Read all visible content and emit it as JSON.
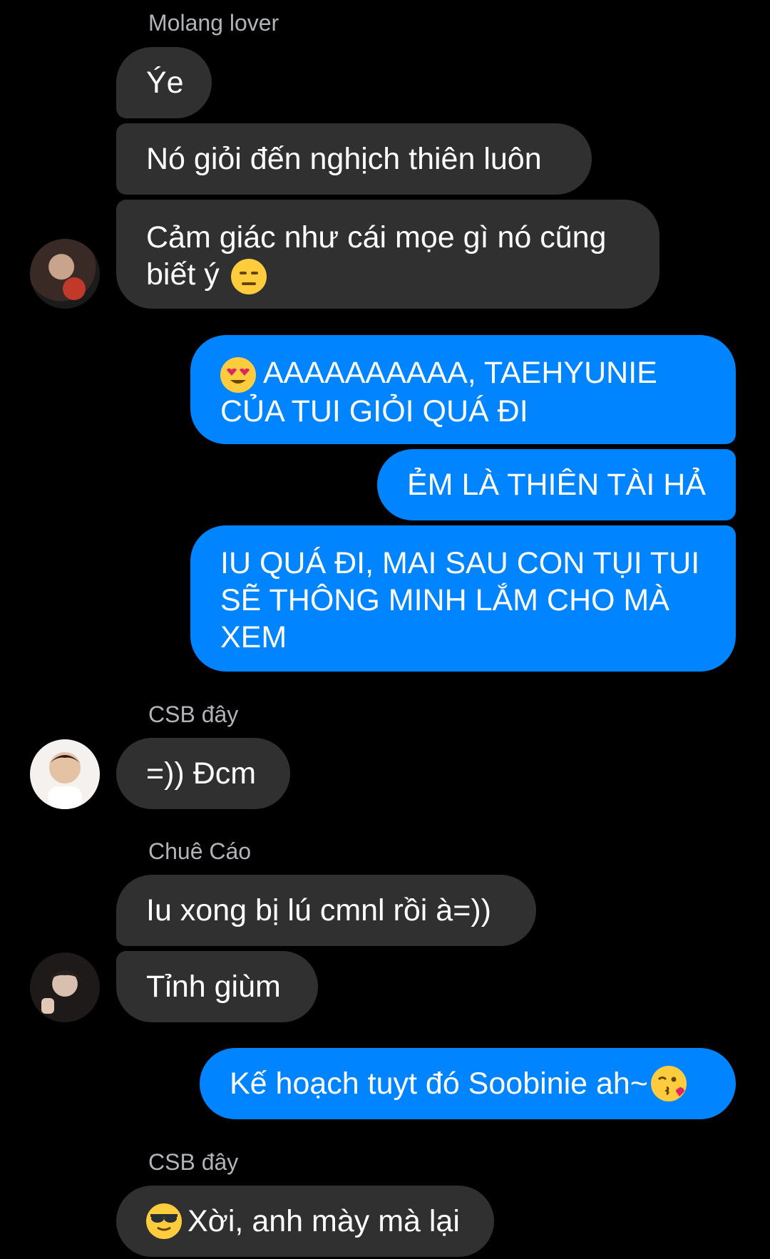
{
  "thread": [
    {
      "sender": "Molang lover"
    },
    {
      "text": "Ýe"
    },
    {
      "text": "Nó giỏi đến nghịch thiên luôn"
    },
    {
      "text": "Cảm giác như cái mọe gì nó cũng biết ý"
    },
    {
      "text": "AAAAAAAAAA, TAEHYUNIE CỦA TUI GIỎI QUÁ ĐI"
    },
    {
      "text": "ẺM LÀ THIÊN TÀI HẢ"
    },
    {
      "text": "IU QUÁ ĐI, MAI SAU CON TỤI TUI SẼ THÔNG MINH LẮM CHO MÀ XEM"
    },
    {
      "sender": "CSB đây"
    },
    {
      "text": "=)) Đcm"
    },
    {
      "sender": "Chuê Cáo"
    },
    {
      "text": "Iu xong bị lú cmnl rồi à=))"
    },
    {
      "text": "Tỉnh giùm"
    },
    {
      "text": "Kế hoạch tuyt đó Soobinie ah~"
    },
    {
      "sender": "CSB đây"
    },
    {
      "text": "Xời, anh mày mà lại"
    }
  ],
  "emojis": {
    "expressionless": "expressionless-face-emoji",
    "heart_eyes": "heart-eyes-emoji",
    "kiss_wink": "face-blowing-kiss-emoji",
    "sunglasses": "sunglasses-face-emoji"
  },
  "colors": {
    "background": "#000000",
    "incoming_bubble": "#303030",
    "outgoing_bubble": "#0084ff",
    "sender_name": "#b0b3b8",
    "text": "#ffffff"
  }
}
